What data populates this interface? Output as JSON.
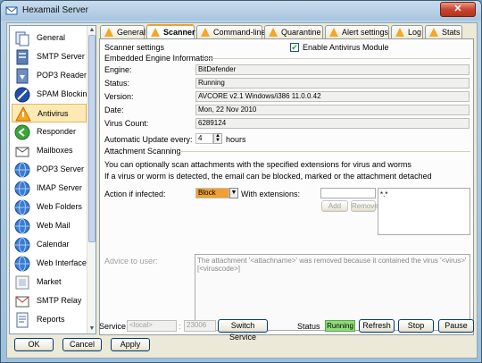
{
  "window": {
    "title": "Hexamail Server",
    "close_glyph": "✕"
  },
  "sidebar": {
    "items": [
      {
        "label": "General",
        "icon": "general-icon"
      },
      {
        "label": "SMTP Server",
        "icon": "smtp-server-icon"
      },
      {
        "label": "POP3 Reader",
        "icon": "pop3-reader-icon"
      },
      {
        "label": "SPAM Blocking",
        "icon": "spam-blocking-icon"
      },
      {
        "label": "Antivirus",
        "icon": "antivirus-icon"
      },
      {
        "label": "Responder",
        "icon": "responder-icon"
      },
      {
        "label": "Mailboxes",
        "icon": "mailboxes-icon"
      },
      {
        "label": "POP3 Server",
        "icon": "pop3-server-icon"
      },
      {
        "label": "IMAP Server",
        "icon": "imap-server-icon"
      },
      {
        "label": "Web Folders",
        "icon": "web-folders-icon"
      },
      {
        "label": "Web Mail",
        "icon": "web-mail-icon"
      },
      {
        "label": "Calendar",
        "icon": "calendar-icon"
      },
      {
        "label": "Web Interface",
        "icon": "web-interface-icon"
      },
      {
        "label": "Market",
        "icon": "market-icon"
      },
      {
        "label": "SMTP Relay",
        "icon": "smtp-relay-icon"
      },
      {
        "label": "Reports",
        "icon": "reports-icon"
      }
    ],
    "selected": "Antivirus"
  },
  "tabs": [
    "General",
    "Scanner",
    "Command-line",
    "Quarantine",
    "Alert settings",
    "Log",
    "Stats"
  ],
  "active_tab": "Scanner",
  "scanner": {
    "section_title": "Scanner settings",
    "enable_label": "Enable Antivirus Module",
    "enable_checked": true,
    "engine_group": "Embedded Engine Information",
    "engine_label": "Engine:",
    "engine_value": "BitDefender",
    "status_label": "Status:",
    "status_value": "Running",
    "version_label": "Version:",
    "version_value": "AVCORE v2.1 Windows/i386 11.0.0.42",
    "date_label": "Date:",
    "date_value": "Mon, 22 Nov 2010",
    "count_label": "Virus Count:",
    "count_value": "6289124",
    "update_label": "Automatic Update every:",
    "update_value": "4",
    "update_unit": "hours",
    "attach_group": "Attachment Scanning",
    "attach_desc1": "You can optionally scan attachments with the specified extensions for virus and worms",
    "attach_desc2": "If a virus or worm is detected, the email can be blocked, marked or the attachment detached",
    "action_label": "Action if infected:",
    "action_value": "Block",
    "ext_label": "With extensions:",
    "ext_list": "*.*",
    "add_label": "Add",
    "remove_label": "Remove",
    "advice_label": "Advice to user:",
    "advice_text": "The attachment '<attachname>' was removed because it contained the virus '<virus>' [<viruscode>]"
  },
  "bottom_bar": {
    "service_label": "Service",
    "host_value": "<local>",
    "port_value": "23006",
    "switch_label": "Switch Service",
    "status_label": "Status",
    "status_value": "Running",
    "refresh_label": "Refresh",
    "stop_label": "Stop",
    "pause_label": "Pause"
  },
  "footer": {
    "ok_label": "OK",
    "cancel_label": "Cancel",
    "apply_label": "Apply"
  },
  "colors": {
    "running_bg": "#8fdc7a",
    "block_bg": "#f0a030",
    "selection_bg": "#fde9b4"
  }
}
